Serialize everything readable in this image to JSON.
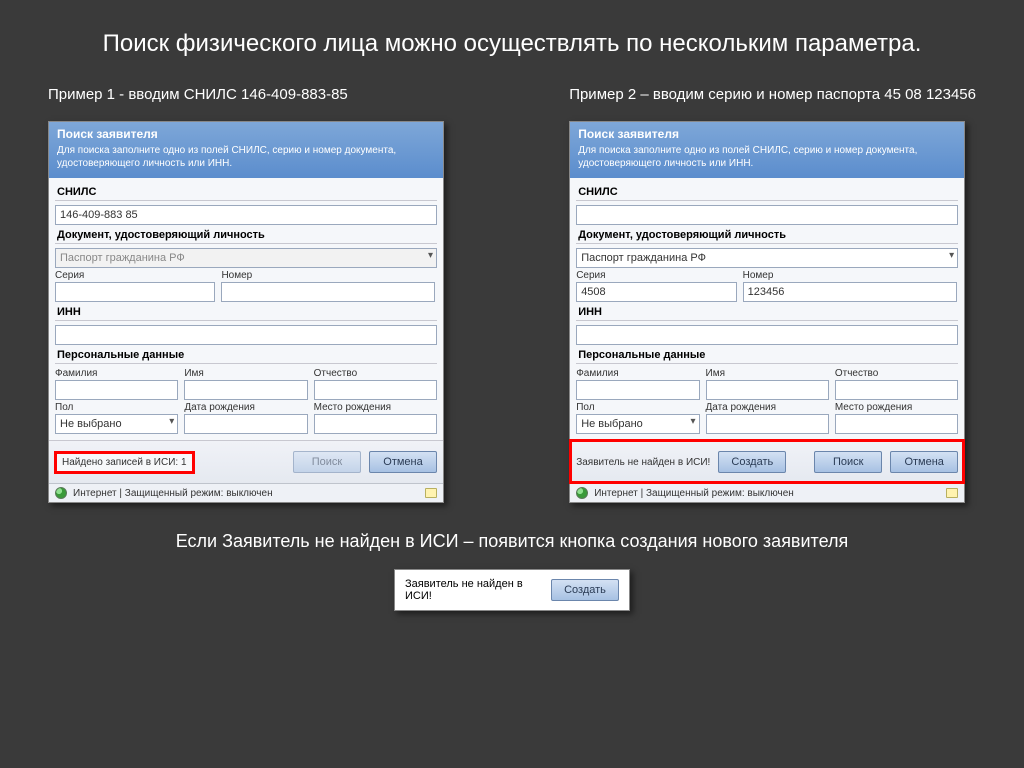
{
  "slide_title": "Поиск физического лица можно осуществлять по нескольким параметра.",
  "example1_caption": "Пример 1 -  вводим СНИЛС 146-409-883-85",
  "example2_caption": "Пример 2 – вводим серию и номер паспорта 45 08 123456",
  "form": {
    "title": "Поиск заявителя",
    "subtitle": "Для поиска заполните одно из полей СНИЛС, серию и номер документа, удостоверяющего личность или ИНН.",
    "labels": {
      "snils": "СНИЛС",
      "doc": "Документ, удостоверяющий личность",
      "doc_select": "Паспорт гражданина РФ",
      "seria": "Серия",
      "nomer": "Номер",
      "inn": "ИНН",
      "personal": "Персональные данные",
      "fam": "Фамилия",
      "imya": "Имя",
      "otch": "Отчество",
      "pol": "Пол",
      "pol_value": "Не выбрано",
      "dob": "Дата рождения",
      "pob": "Место рождения"
    },
    "btn_search": "Поиск",
    "btn_cancel": "Отмена",
    "btn_create": "Создать",
    "statusbar": "Интернет | Защищенный режим: выключен"
  },
  "ex1": {
    "snils_value": "146-409-883 85",
    "footer_status": "Найдено записей в ИСИ: 1"
  },
  "ex2": {
    "seria_value": "4508",
    "nomer_value": "123456",
    "footer_status": "Заявитель не найден в ИСИ!"
  },
  "bottom_caption": "Если Заявитель не найден в ИСИ – появится кнопка создания нового заявителя",
  "float_msg": "Заявитель не найден в ИСИ!",
  "float_btn": "Создать"
}
